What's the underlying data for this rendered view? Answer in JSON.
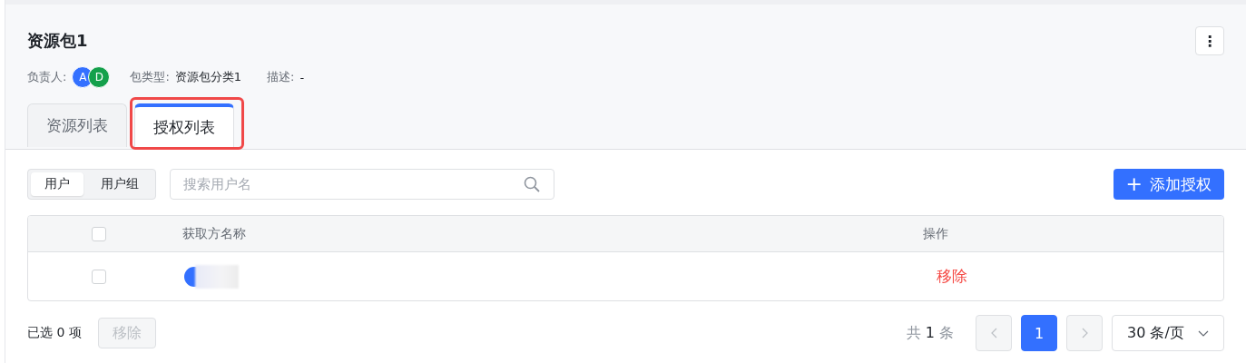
{
  "header": {
    "title": "资源包1",
    "more_icon": "⋮",
    "meta": [
      {
        "kind": "owners",
        "label": "负责人:",
        "avatars": [
          {
            "letter": "A",
            "color": "#3370ff"
          },
          {
            "letter": "D",
            "color": "#14a04b"
          }
        ]
      },
      {
        "kind": "text",
        "label": "包类型:",
        "value": "资源包分类1"
      },
      {
        "kind": "text",
        "label": "描述:",
        "value": "-"
      }
    ]
  },
  "tabs": [
    {
      "label": "资源列表",
      "selected": false
    },
    {
      "label": "授权列表",
      "selected": true,
      "highlighted": true
    }
  ],
  "toolbar": {
    "segments": [
      {
        "label": "用户",
        "selected": true
      },
      {
        "label": "用户组",
        "selected": false
      }
    ],
    "search": {
      "placeholder": "搜索用户名"
    },
    "add_button": {
      "icon": "+",
      "label": "添加授权"
    }
  },
  "table": {
    "header_checked": false,
    "columns": [
      "获取方名称",
      "操作"
    ],
    "rows": [
      {
        "checked": false,
        "color": "#3370ff",
        "action": "移除"
      }
    ]
  },
  "footer": {
    "selected_count": "已选 0 项",
    "remove_button": {
      "label": "移除",
      "disabled": true
    },
    "total": {
      "prefix": "共",
      "count": "1",
      "suffix": "条"
    },
    "pages": [
      {
        "label": "1",
        "selected": true
      }
    ],
    "page_size": "30 条/页"
  }
}
